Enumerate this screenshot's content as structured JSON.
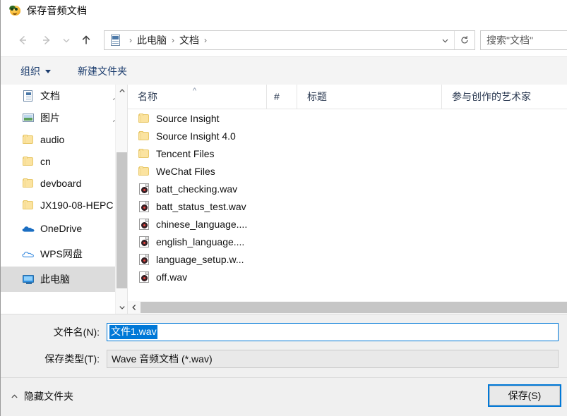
{
  "window": {
    "title": "保存音频文档",
    "icon": "app-smiley-icon"
  },
  "nav": {
    "back_icon": "back-arrow-icon",
    "forward_icon": "forward-arrow-icon",
    "recent_icon": "recent-locations-chevron-icon",
    "up_icon": "up-arrow-icon",
    "breadcrumb": {
      "root_icon": "documents-icon",
      "items": [
        "此电脑",
        "文档"
      ],
      "separator": "›",
      "dropdown_icon": "chevron-down-icon",
      "refresh_icon": "refresh-icon"
    },
    "search": {
      "placeholder": "搜索\"文档\"",
      "icon": "search-icon"
    }
  },
  "toolbar": {
    "organize_label": "组织",
    "new_folder_label": "新建文件夹"
  },
  "sidebar": {
    "items": [
      {
        "label": "文档",
        "icon": "documents-icon",
        "pinned": true,
        "selected": false
      },
      {
        "label": "图片",
        "icon": "pictures-icon",
        "pinned": true,
        "selected": false
      },
      {
        "label": "audio",
        "icon": "folder-icon",
        "pinned": false,
        "selected": false
      },
      {
        "label": "cn",
        "icon": "folder-icon",
        "pinned": false,
        "selected": false
      },
      {
        "label": "devboard",
        "icon": "folder-icon",
        "pinned": false,
        "selected": false
      },
      {
        "label": "JX190-08-HEPC",
        "icon": "folder-icon",
        "pinned": false,
        "selected": false
      },
      {
        "label": "OneDrive",
        "icon": "onedrive-cloud-icon",
        "pinned": false,
        "selected": false
      },
      {
        "label": "WPS网盘",
        "icon": "wps-cloud-icon",
        "pinned": false,
        "selected": false
      },
      {
        "label": "此电脑",
        "icon": "this-pc-icon",
        "pinned": false,
        "selected": true
      }
    ],
    "scrollbar": {
      "up_icon": "scroll-up-icon",
      "down_icon": "scroll-down-icon"
    }
  },
  "filelist": {
    "columns": [
      {
        "label": "名称",
        "sorted": "asc"
      },
      {
        "label": "#",
        "sorted": ""
      },
      {
        "label": "标题",
        "sorted": ""
      },
      {
        "label": "参与创作的艺术家",
        "sorted": ""
      }
    ],
    "sort_caret": "^",
    "rows": [
      {
        "name": "Source Insight",
        "icon": "folder-icon"
      },
      {
        "name": "Source Insight 4.0",
        "icon": "folder-icon"
      },
      {
        "name": "Tencent Files",
        "icon": "folder-icon"
      },
      {
        "name": "WeChat Files",
        "icon": "folder-icon"
      },
      {
        "name": "batt_checking.wav",
        "icon": "wav-file-icon"
      },
      {
        "name": "batt_status_test.wav",
        "icon": "wav-file-icon"
      },
      {
        "name": "chinese_language....",
        "icon": "wav-file-icon"
      },
      {
        "name": "english_language....",
        "icon": "wav-file-icon"
      },
      {
        "name": "language_setup.w...",
        "icon": "wav-file-icon"
      },
      {
        "name": "off.wav",
        "icon": "wav-file-icon"
      }
    ],
    "hscroll_left_icon": "scroll-left-icon"
  },
  "form": {
    "filename_label": "文件名(N):",
    "filename_value": "文件1.wav",
    "filetype_label": "保存类型(T):",
    "filetype_value": "Wave 音频文档 (*.wav)"
  },
  "footer": {
    "hide_folders_label": "隐藏文件夹",
    "hide_folders_icon": "chevron-up-icon",
    "save_label": "保存(S)"
  },
  "colors": {
    "accent": "#0078d7",
    "toolbar_link": "#1c3d6e",
    "selection_bg": "#0078d7",
    "panel_bg": "#f0f0f0",
    "row_selected_bg": "#dcdcdc"
  }
}
